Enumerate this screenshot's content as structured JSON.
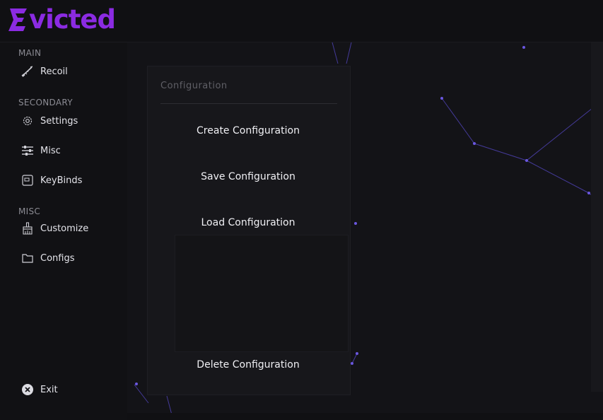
{
  "app": {
    "logo_text": "victed",
    "brand_color": "#8b2be2",
    "accent_line_color": "#5a47c9"
  },
  "sidebar": {
    "sections": [
      {
        "label": "MAIN"
      },
      {
        "label": "SECONDARY"
      },
      {
        "label": "MISC"
      }
    ],
    "items": [
      {
        "label": "Recoil",
        "icon": "rifle-icon"
      },
      {
        "label": "Settings",
        "icon": "gear-icon"
      },
      {
        "label": "Misc",
        "icon": "sliders-icon"
      },
      {
        "label": "KeyBinds",
        "icon": "keyboard-key-icon"
      },
      {
        "label": "Customize",
        "icon": "paint-brush-icon"
      },
      {
        "label": "Configs",
        "icon": "folder-icon"
      }
    ],
    "exit": {
      "label": "Exit",
      "icon": "close-circle-icon"
    }
  },
  "panel": {
    "title": "Configuration",
    "buttons": {
      "create": "Create Configuration",
      "save": "Save Configuration",
      "load": "Load Configuration",
      "delete": "Delete Configuration"
    }
  }
}
